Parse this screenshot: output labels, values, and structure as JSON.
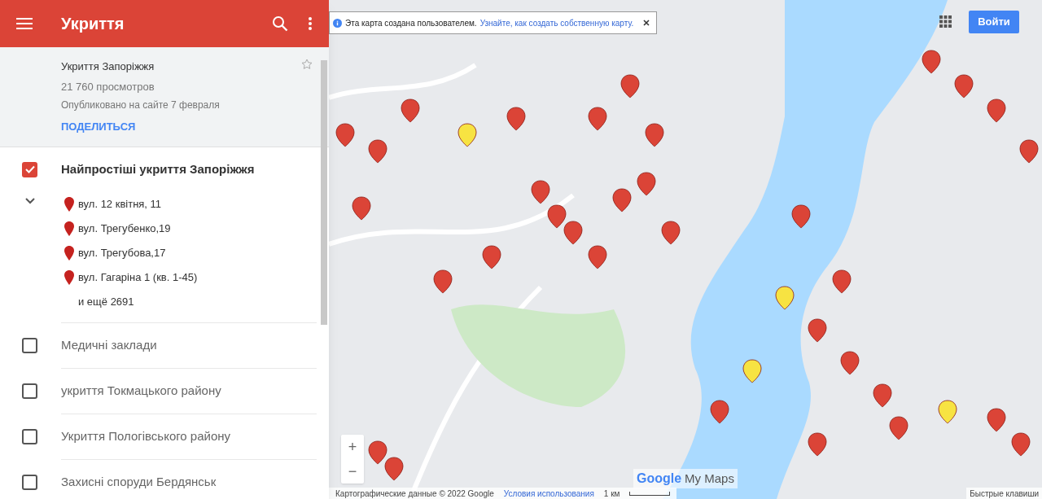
{
  "app_bar": {
    "title": "Укриття"
  },
  "map_info": {
    "title": "Укриття Запоріжжя",
    "views": "21 760 просмотров",
    "published": "Опубликовано на сайте 7 февраля",
    "share": "ПОДЕЛИТЬСЯ"
  },
  "layers": [
    {
      "name": "Найпростіші укриття Запоріжжя",
      "checked": true,
      "expanded": true,
      "items": [
        "вул. 12 квітня, 11",
        "вул. Трегубенко,19",
        "вул. Трегубова,17",
        "вул. Гагаріна 1 (кв. 1-45)"
      ],
      "more": "и ещё 2691"
    },
    {
      "name": "Медичні заклади",
      "checked": false,
      "expanded": false
    },
    {
      "name": "укриття Токмацького району",
      "checked": false,
      "expanded": false
    },
    {
      "name": "Укриття Пологівського району",
      "checked": false,
      "expanded": false
    },
    {
      "name": "Захисні споруди Бердянськ",
      "checked": false,
      "expanded": false
    }
  ],
  "notice": {
    "text": "Эта карта создана пользователем.",
    "link": "Узнайте, как создать собственную карту."
  },
  "sign_in": "Войти",
  "zoom": [
    "+",
    "−"
  ],
  "logo": {
    "google": "Google",
    "product": "My Maps"
  },
  "footer": {
    "data": "Картографические данные © 2022 Google",
    "terms": "Условия использования",
    "scale": "1 км",
    "shortcuts": "Быстрые клавиши"
  }
}
